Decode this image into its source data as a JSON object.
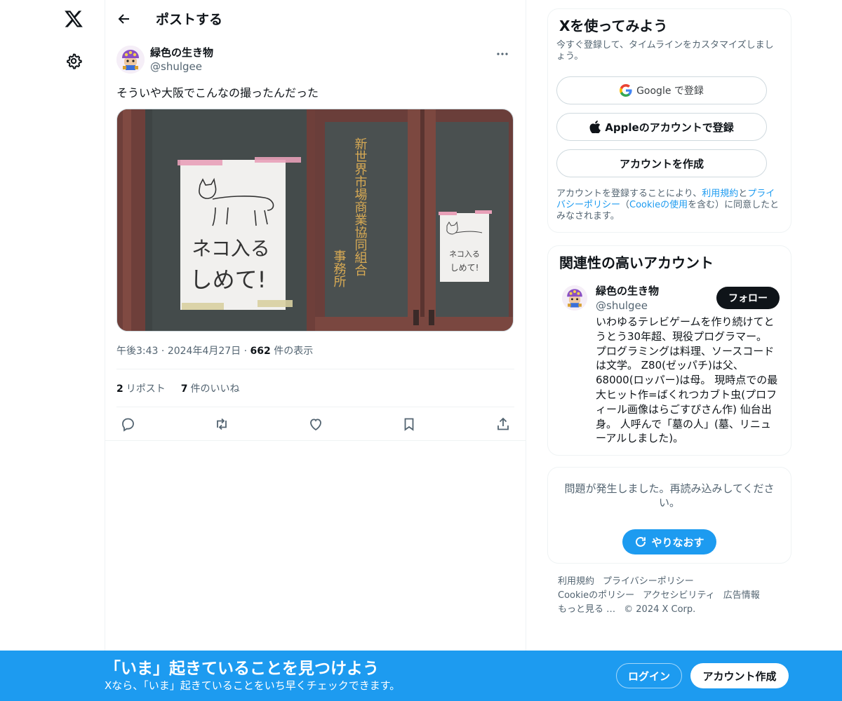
{
  "colors": {
    "accent": "#1d9bf0",
    "text": "#0f1419",
    "secondary": "#536471",
    "border": "#eff3f4"
  },
  "nav": {
    "logo_icon": "x-logo-icon",
    "settings_icon": "gear-icon"
  },
  "header": {
    "title": "ポストする",
    "back_icon": "arrow-left-icon"
  },
  "post": {
    "author_name": "緑色の生き物",
    "author_handle": "@shulgee",
    "text": "そういや大阪でこんなの撮ったんだった",
    "time": "午後3:43",
    "date": "2024年4月27日",
    "views_count": "662",
    "views_label": "件の表示",
    "reposts_count": "2",
    "reposts_label": "リポスト",
    "likes_count": "7",
    "likes_label": "件のいいね",
    "image1_text": [
      "ネコ入る",
      "しめて!"
    ],
    "image2_sign": "新世界市場商業協同組合",
    "image2_sign2": "事務所",
    "image2_note": [
      "ネコ入る",
      "しめて!"
    ]
  },
  "signup": {
    "title": "Xを使ってみよう",
    "desc": "今すぐ登録して、タイムラインをカスタマイズしましょう。",
    "google_label": "Google で登録",
    "apple_label": "Appleのアカウントで登録",
    "create_label": "アカウントを作成",
    "legal_pre": "アカウントを登録することにより、",
    "legal_terms": "利用規約",
    "legal_and": "と",
    "legal_privacy": "プライバシーポリシー",
    "legal_mid": "（",
    "legal_cookie": "Cookieの使用",
    "legal_post": "を含む）に同意したとみなされます。"
  },
  "related": {
    "title": "関連性の高いアカウント",
    "name": "緑色の生き物",
    "handle": "@shulgee",
    "follow_label": "フォロー",
    "bio": "いわゆるテレビゲームを作り続けてとうとう30年超、現役プログラマー。 プログラミングは料理、ソースコードは文学。 Z80(ゼッパチ)は父、68000(ロッパー)は母。 現時点での最大ヒット作=ばくれつカブト虫(プロフィール画像はらごすぴさん作) 仙台出身。 人呼んで「墓の人」(墓、リニューアルしました)。"
  },
  "error": {
    "text": "問題が発生しました。再読み込みしてください。",
    "retry_label": "やりなおす"
  },
  "footer": {
    "links": [
      "利用規約",
      "プライバシーポリシー",
      "Cookieのポリシー",
      "アクセシビリティ",
      "広告情報",
      "もっと見る …",
      "© 2024 X Corp."
    ]
  },
  "banner": {
    "title": "「いま」起きていることを見つけよう",
    "subtitle": "Xなら、「いま」起きていることをいち早くチェックできます。",
    "login_label": "ログイン",
    "signup_label": "アカウント作成"
  }
}
